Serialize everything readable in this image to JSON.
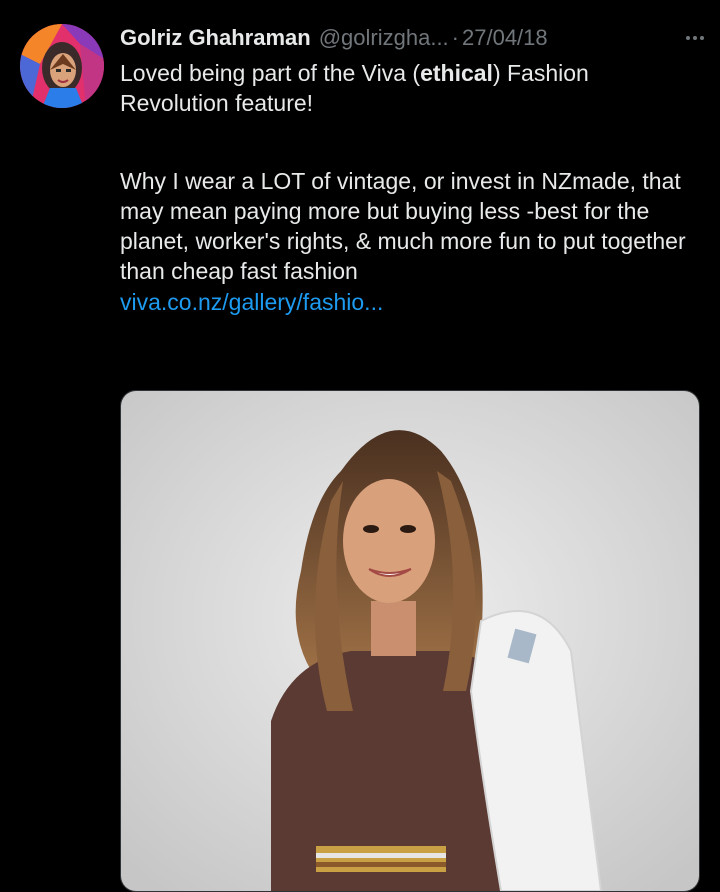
{
  "tweet": {
    "author": {
      "name": "Golriz Ghahraman",
      "handle": "@golrizgha...",
      "avatar_icon": "profile-portrait-avatar"
    },
    "separator": "·",
    "date": "27/04/18",
    "more_icon": "more-horizontal-icon",
    "text": {
      "line1_before": "Loved being part of the Viva (",
      "line1_bold": "ethical",
      "line1_after": ") Fashion Revolution feature!",
      "paragraph2": "Why I wear a LOT of vintage, or invest in NZmade, that may mean paying more but buying less -best for the planet, worker's rights, & much more fun to put together than cheap fast fashion",
      "link": "viva.co.nz/gallery/fashio..."
    },
    "media": {
      "type": "photo"
    }
  },
  "colors": {
    "background": "#000000",
    "text_primary": "#e7e9ea",
    "text_secondary": "#71767b",
    "link": "#1d9bf0"
  }
}
